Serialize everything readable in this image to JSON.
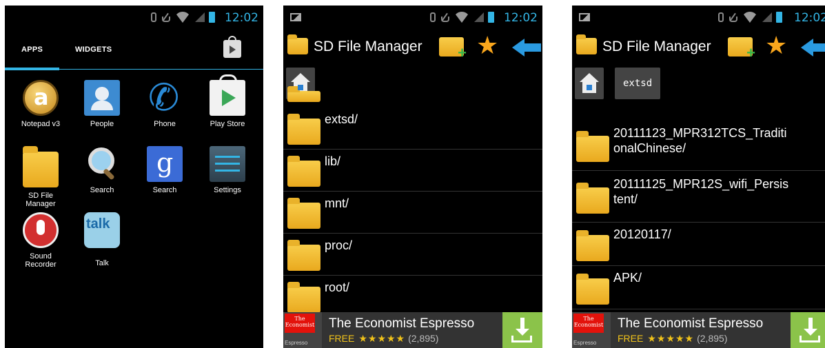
{
  "status": {
    "time": "12:02"
  },
  "launcher": {
    "tabs": {
      "apps": "APPS",
      "widgets": "WIDGETS"
    },
    "apps": [
      {
        "label": "Notepad v3",
        "icon": "notepad-icon"
      },
      {
        "label": "People",
        "icon": "people-icon"
      },
      {
        "label": "Phone",
        "icon": "phone-icon"
      },
      {
        "label": "Play Store",
        "icon": "play-store-icon"
      },
      {
        "label": "SD File\nManager",
        "icon": "folder-icon"
      },
      {
        "label": "Search",
        "icon": "magnifier-icon"
      },
      {
        "label": "Search",
        "icon": "google-search-icon"
      },
      {
        "label": "Settings",
        "icon": "settings-icon"
      },
      {
        "label": "Sound\nRecorder",
        "icon": "microphone-icon"
      },
      {
        "label": "Talk",
        "icon": "talk-icon"
      }
    ]
  },
  "file_manager": {
    "title": "SD File Manager",
    "screen2": {
      "entries": [
        "extsd/",
        "lib/",
        "mnt/",
        "proc/",
        "root/"
      ]
    },
    "screen3": {
      "path": "extsd",
      "entries": [
        "20111123_MPR312TCS_Traditi\nonalChinese/",
        "20111125_MPR12S_wifi_Persis\ntent/",
        "20120117/",
        "APK/"
      ]
    }
  },
  "ad": {
    "brand_line1": "The",
    "brand_line2": "Economist",
    "brand_sub": "Espresso",
    "title": "The Economist Espresso",
    "price": "FREE",
    "stars": "★★★★★",
    "rating_count": "(2,895)"
  },
  "colors": {
    "accent": "#33b5e5",
    "ad_download": "#8bc34a",
    "brand_red": "#e3120b"
  }
}
